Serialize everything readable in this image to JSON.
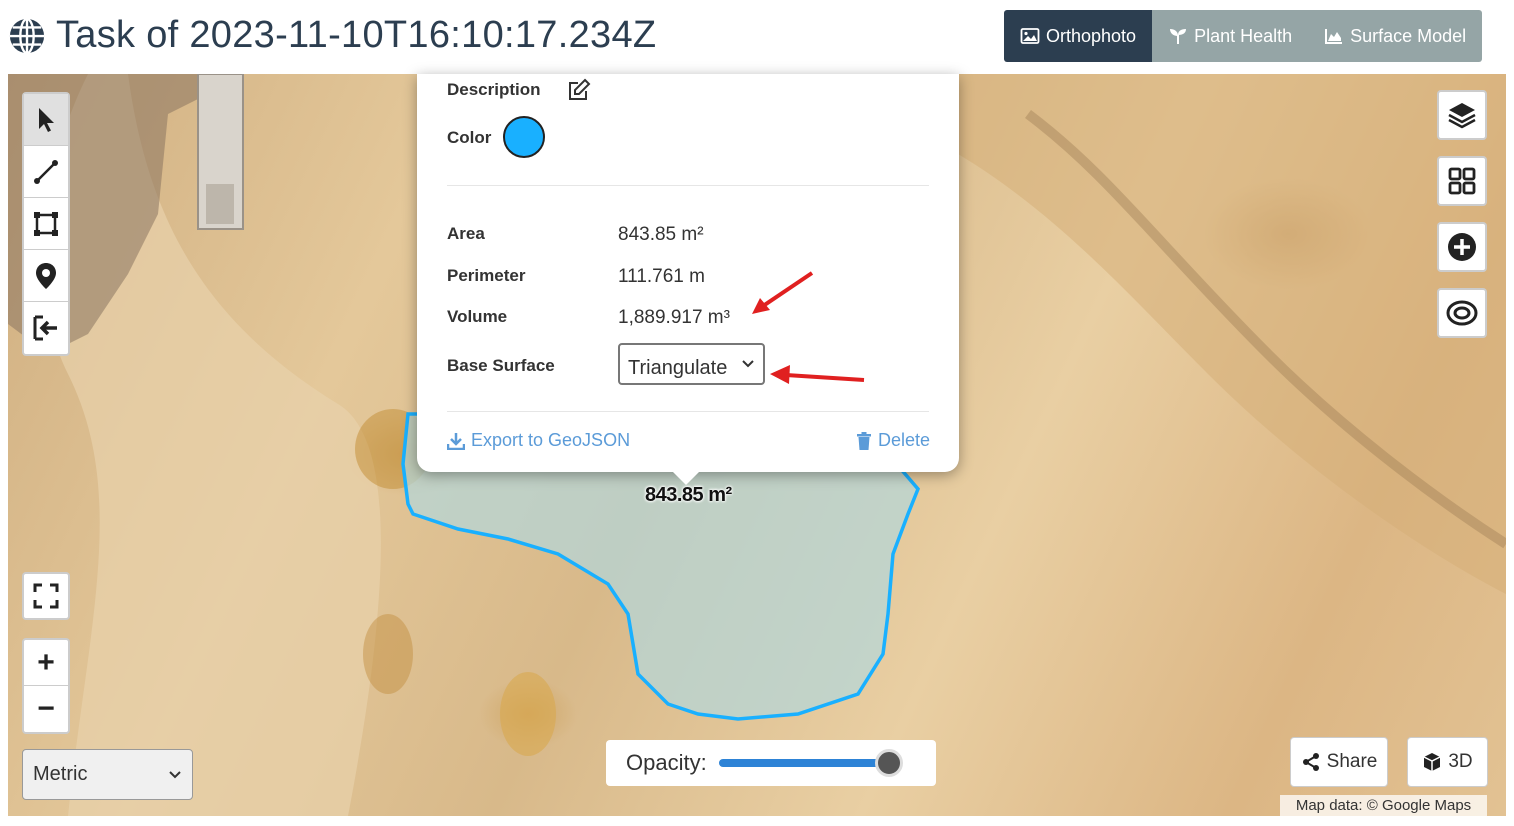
{
  "header": {
    "title": "Task of 2023-11-10T16:10:17.234Z",
    "tabs": [
      {
        "label": "Orthophoto",
        "icon": "image-icon",
        "active": true
      },
      {
        "label": "Plant Health",
        "icon": "seedling-icon",
        "active": false
      },
      {
        "label": "Surface Model",
        "icon": "chart-area-icon",
        "active": false
      }
    ]
  },
  "popup": {
    "description_label": "Description",
    "color_label": "Color",
    "color_value": "#19b0ff",
    "area_label": "Area",
    "area_value": "843.85 m²",
    "perimeter_label": "Perimeter",
    "perimeter_value": "111.761 m",
    "volume_label": "Volume",
    "volume_value": "1,889.917 m³",
    "base_surface_label": "Base Surface",
    "base_surface_value": "Triangulate",
    "export_label": "Export to GeoJSON",
    "delete_label": "Delete"
  },
  "map": {
    "polygon_label": "843.85 m²",
    "units_value": "Metric",
    "opacity_label": "Opacity:",
    "opacity_value": 1.0,
    "share_label": "Share",
    "three_d_label": "3D",
    "attribution": "Map data: © Google Maps",
    "zoom_in": "+",
    "zoom_out": "−"
  },
  "colors": {
    "accent": "#2c3e50",
    "tab_inactive": "#95a5a6",
    "polygon": "#19b0ff",
    "link": "#5b9bd8",
    "arrow": "#e02020"
  }
}
